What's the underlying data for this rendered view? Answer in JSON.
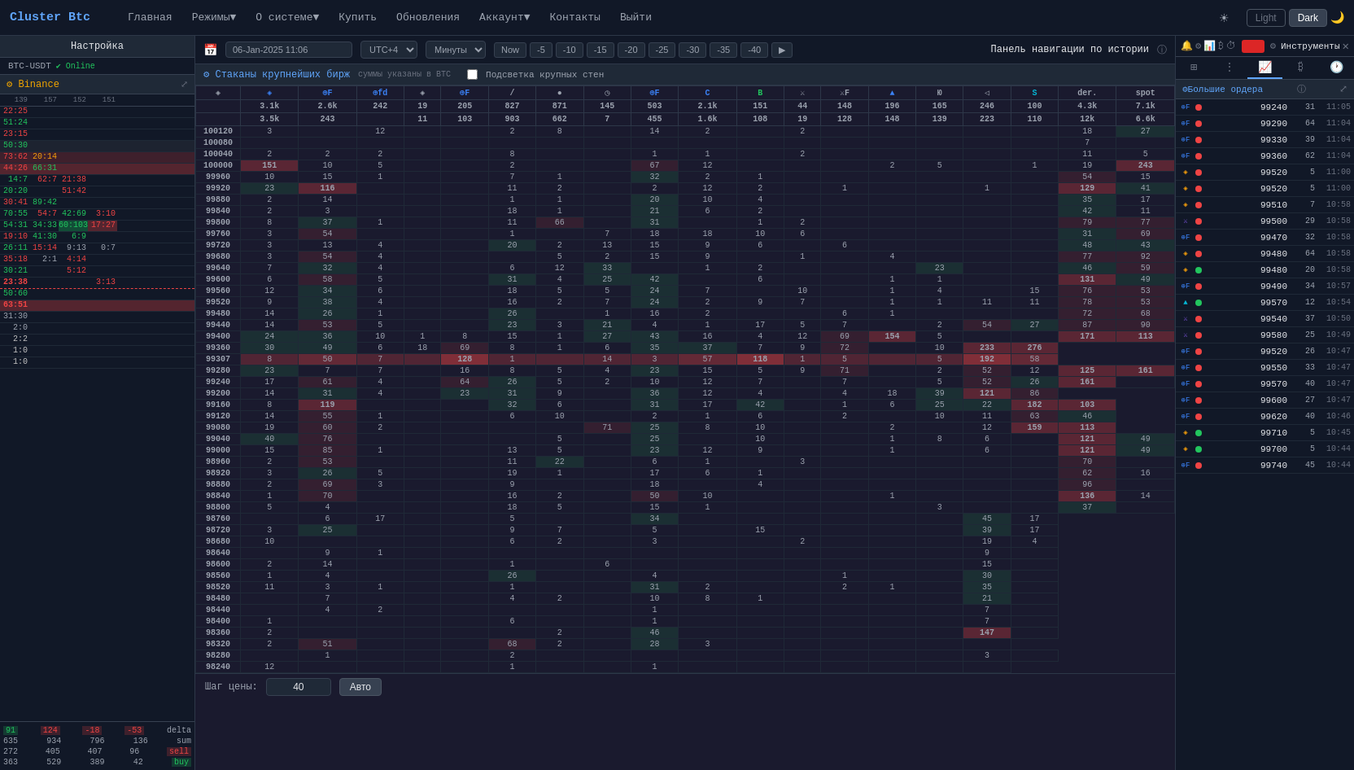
{
  "brand": "Cluster Btc",
  "nav": {
    "links": [
      "Главная",
      "Режимы▼",
      "О системе▼",
      "Купить",
      "Обновления",
      "Аккаунт▼",
      "Контакты",
      "Выйти"
    ],
    "theme": {
      "light": "Light",
      "dark": "Dark"
    }
  },
  "settings": {
    "title": "Настройка",
    "pair": "BTC-USDT",
    "status": "Online"
  },
  "history_nav": {
    "title": "Панель навигации по истории",
    "date": "06-Jan-2025 11:06",
    "tz": "UTC+4",
    "period": "Минуты",
    "btns": [
      "Now",
      "-5",
      "-10",
      "-15",
      "-20",
      "-25",
      "-30",
      "-35",
      "-40"
    ]
  },
  "instruments": {
    "title": "Инструменты"
  },
  "exchange": {
    "name": "⚙ Binance"
  },
  "cluster": {
    "title": "⚙ Стаканы крупнейших бирж",
    "note": "суммы указаны в BTC",
    "highlight": "Подсветка крупных стен"
  },
  "big_orders": {
    "title": "⚙Большие ордера"
  },
  "columns": {
    "headers": [
      "",
      "◈",
      "⊕F",
      "⊕fd",
      "◈",
      "⊕F",
      "/",
      "●",
      "◷",
      "⊕F",
      "C",
      "B",
      "⚔",
      "⚔F",
      "▲",
      "Ю",
      "◁",
      "S",
      "der.",
      "spot"
    ],
    "subvals": [
      "",
      "3.1k",
      "2.6k",
      "242",
      "19",
      "205",
      "827",
      "871",
      "145",
      "503",
      "2.1k",
      "151",
      "44",
      "148",
      "196",
      "165",
      "246",
      "100",
      "4.3k",
      "7.1k"
    ],
    "subvals2": [
      "",
      "3.5k",
      "243",
      "",
      "11",
      "103",
      "903",
      "662",
      "7",
      "455",
      "1.6k",
      "108",
      "19",
      "128",
      "148",
      "139",
      "223",
      "110",
      "12k",
      "6.6k"
    ]
  },
  "prices": [
    100120,
    100080,
    100040,
    100000,
    99960,
    99920,
    99880,
    99840,
    99800,
    99760,
    99720,
    99680,
    99640,
    99600,
    99560,
    99520,
    99480,
    99440,
    99400,
    99360,
    99307,
    99280,
    99240,
    99200,
    99160,
    99120,
    99080,
    99040,
    99000,
    98960,
    98920,
    98880,
    98840,
    98800,
    98760,
    98720,
    98680,
    98640,
    98600,
    98560,
    98520,
    98480,
    98440,
    98400,
    98360,
    98320,
    98280,
    98240
  ],
  "orders_list": [
    {
      "exchange": "⊕F",
      "side": "sell",
      "price": "99240",
      "size": "31",
      "time": "11:05"
    },
    {
      "exchange": "⊕F",
      "side": "sell",
      "price": "99290",
      "size": "64",
      "time": "11:04"
    },
    {
      "exchange": "⊕F",
      "side": "sell",
      "price": "99330",
      "size": "39",
      "time": "11:04"
    },
    {
      "exchange": "⊕F",
      "side": "sell",
      "price": "99360",
      "size": "62",
      "time": "11:04"
    },
    {
      "exchange": "◈",
      "side": "sell",
      "price": "99520",
      "size": "5",
      "time": "11:00"
    },
    {
      "exchange": "◈",
      "side": "sell",
      "price": "99520",
      "size": "5",
      "time": "11:00"
    },
    {
      "exchange": "◈",
      "side": "sell",
      "price": "99510",
      "size": "7",
      "time": "10:58"
    },
    {
      "exchange": "⚔",
      "side": "sell",
      "price": "99500",
      "size": "29",
      "time": "10:58"
    },
    {
      "exchange": "⊕F",
      "side": "sell",
      "price": "99470",
      "size": "32",
      "time": "10:58"
    },
    {
      "exchange": "◈",
      "side": "sell",
      "price": "99480",
      "size": "64",
      "time": "10:58"
    },
    {
      "exchange": "◈",
      "side": "buy",
      "price": "99480",
      "size": "20",
      "time": "10:58"
    },
    {
      "exchange": "⊕F",
      "side": "sell",
      "price": "99490",
      "size": "34",
      "time": "10:57"
    },
    {
      "exchange": "▲",
      "side": "buy",
      "price": "99570",
      "size": "12",
      "time": "10:54"
    },
    {
      "exchange": "⚔",
      "side": "sell",
      "price": "99540",
      "size": "37",
      "time": "10:50"
    },
    {
      "exchange": "⚔",
      "side": "sell",
      "price": "99580",
      "size": "25",
      "time": "10:49"
    },
    {
      "exchange": "⊕F",
      "side": "sell",
      "price": "99520",
      "size": "26",
      "time": "10:47"
    },
    {
      "exchange": "⊕F",
      "side": "sell",
      "price": "99550",
      "size": "33",
      "time": "10:47"
    },
    {
      "exchange": "⊕F",
      "side": "sell",
      "price": "99570",
      "size": "40",
      "time": "10:47"
    },
    {
      "exchange": "⊕F",
      "side": "sell",
      "price": "99600",
      "size": "27",
      "time": "10:47"
    },
    {
      "exchange": "⊕F",
      "side": "sell",
      "price": "99620",
      "size": "40",
      "time": "10:46"
    },
    {
      "exchange": "◈",
      "side": "buy",
      "price": "99710",
      "size": "5",
      "time": "10:45"
    },
    {
      "exchange": "◈",
      "side": "buy",
      "price": "99700",
      "size": "5",
      "time": "10:44"
    },
    {
      "exchange": "⊕F",
      "side": "sell",
      "price": "99740",
      "size": "45",
      "time": "10:44"
    }
  ],
  "step": {
    "label": "Шаг цены:",
    "value": "40",
    "auto": "Авто"
  },
  "left_col_data": {
    "labels": [
      "139",
      "157",
      "152",
      "151"
    ],
    "rows": [
      {
        "price": "100120",
        "v1": "3",
        "v2": "",
        "v3": "12",
        "bar": false,
        "red_bar": false
      },
      {
        "price": "100080",
        "v1": "",
        "v2": "",
        "v3": "",
        "bar": false,
        "red_bar": false
      },
      {
        "price": "100040",
        "v1": "2",
        "v2": "2",
        "v3": "2",
        "bar": false,
        "red_bar": false
      },
      {
        "price": "100000",
        "v1": "151",
        "v2": "10",
        "v3": "5",
        "bar": true,
        "red_bar": false
      },
      {
        "price": "99960",
        "v1": "10",
        "v2": "15",
        "v3": "1",
        "bar": false,
        "red_bar": false
      },
      {
        "price": "99920",
        "v1": "23",
        "v2": "116",
        "v3": "",
        "bar": false,
        "red_bar": false
      },
      {
        "price": "99880",
        "v1": "2",
        "v2": "14",
        "v3": "",
        "bar": false,
        "red_bar": false
      },
      {
        "price": "99840",
        "v1": "2",
        "v2": "3",
        "v3": "",
        "bar": false,
        "red_bar": false
      },
      {
        "price": "99800",
        "v1": "8",
        "v2": "37",
        "v3": "1",
        "bar": false,
        "red_bar": false
      },
      {
        "price": "99760",
        "v1": "3",
        "v2": "54",
        "v3": "",
        "bar": false,
        "red_bar": false
      },
      {
        "price": "99720",
        "v1": "3",
        "v2": "13",
        "v3": "4",
        "bar": false,
        "red_bar": false
      },
      {
        "price": "99680",
        "v1": "3",
        "v2": "54",
        "v3": "4",
        "bar": false,
        "red_bar": false
      },
      {
        "price": "99640",
        "v1": "7",
        "v2": "32",
        "v3": "4",
        "bar": false,
        "red_bar": false
      },
      {
        "price": "99600",
        "v1": "6",
        "v2": "58",
        "v3": "5",
        "bar": false,
        "red_bar": false
      },
      {
        "price": "99560",
        "v1": "12",
        "v2": "34",
        "v3": "6",
        "bar": false,
        "red_bar": false
      },
      {
        "price": "99520",
        "v1": "9",
        "v2": "38",
        "v3": "4",
        "bar": false,
        "red_bar": false
      },
      {
        "price": "99480",
        "v1": "14",
        "v2": "26",
        "v3": "1",
        "bar": false,
        "red_bar": false
      },
      {
        "price": "99440",
        "v1": "14",
        "v2": "53",
        "v3": "5",
        "bar": false,
        "red_bar": false
      },
      {
        "price": "99400",
        "v1": "24",
        "v2": "36",
        "v3": "10",
        "bar": false,
        "red_bar": false
      },
      {
        "price": "99360",
        "v1": "30",
        "v2": "49",
        "v3": "6",
        "bar": false,
        "red_bar": false
      },
      {
        "price": "99307",
        "v1": "8",
        "v2": "50",
        "v3": "7",
        "bar": false,
        "red_bar": true
      },
      {
        "price": "99280",
        "v1": "23",
        "v2": "7",
        "v3": "7",
        "bar": false,
        "red_bar": false
      },
      {
        "price": "99240",
        "v1": "17",
        "v2": "61",
        "v3": "4",
        "bar": false,
        "red_bar": false
      },
      {
        "price": "99200",
        "v1": "14",
        "v2": "31",
        "v3": "4",
        "bar": false,
        "red_bar": false
      },
      {
        "price": "99160",
        "v1": "8",
        "v2": "119",
        "v3": "",
        "bar": false,
        "red_bar": false
      },
      {
        "price": "99120",
        "v1": "14",
        "v2": "55",
        "v3": "1",
        "bar": false,
        "red_bar": false
      },
      {
        "price": "99080",
        "v1": "19",
        "v2": "60",
        "v3": "2",
        "bar": false,
        "red_bar": false
      },
      {
        "price": "99040",
        "v1": "40",
        "v2": "76",
        "v3": "",
        "bar": false,
        "red_bar": false
      },
      {
        "price": "99000",
        "v1": "15",
        "v2": "85",
        "v3": "1",
        "bar": false,
        "red_bar": false
      },
      {
        "price": "98960",
        "v1": "2",
        "v2": "53",
        "v3": "",
        "bar": false,
        "red_bar": false
      },
      {
        "price": "98920",
        "v1": "3",
        "v2": "26",
        "v3": "5",
        "bar": false,
        "red_bar": false
      },
      {
        "price": "98880",
        "v1": "2",
        "v2": "69",
        "v3": "3",
        "bar": false,
        "red_bar": false
      },
      {
        "price": "98840",
        "v1": "1",
        "v2": "70",
        "v3": "",
        "bar": false,
        "red_bar": false
      },
      {
        "price": "98800",
        "v1": "5",
        "v2": "4",
        "v3": "",
        "bar": false,
        "red_bar": false
      },
      {
        "price": "98760",
        "v1": "",
        "v2": "6",
        "v3": "17",
        "bar": false,
        "red_bar": false
      },
      {
        "price": "98720",
        "v1": "3",
        "v2": "25",
        "v3": "",
        "bar": false,
        "red_bar": false
      },
      {
        "price": "98680",
        "v1": "10",
        "v2": "",
        "v3": "",
        "bar": false,
        "red_bar": false
      },
      {
        "price": "98640",
        "v1": "",
        "v2": "9",
        "v3": "1",
        "bar": false,
        "red_bar": false
      },
      {
        "price": "98600",
        "v1": "2",
        "v2": "14",
        "v3": "",
        "bar": false,
        "red_bar": false
      },
      {
        "price": "98560",
        "v1": "1",
        "v2": "4",
        "v3": "",
        "bar": false,
        "red_bar": false
      },
      {
        "price": "98520",
        "v1": "11",
        "v2": "3",
        "v3": "1",
        "bar": false,
        "red_bar": false
      },
      {
        "price": "98480",
        "v1": "",
        "v2": "7",
        "v3": "",
        "bar": false,
        "red_bar": false
      },
      {
        "price": "98440",
        "v1": "",
        "v2": "4",
        "v3": "2",
        "bar": false,
        "red_bar": false
      },
      {
        "price": "98400",
        "v1": "1",
        "v2": "",
        "v3": "",
        "bar": false,
        "red_bar": false
      },
      {
        "price": "98360",
        "v1": "2",
        "v2": "",
        "v3": "",
        "bar": false,
        "red_bar": false
      },
      {
        "price": "98320",
        "v1": "2",
        "v2": "51",
        "v3": "",
        "bar": false,
        "red_bar": false
      },
      {
        "price": "98280",
        "v1": "",
        "v2": "1",
        "v3": "",
        "bar": false,
        "red_bar": false
      },
      {
        "price": "98240",
        "v1": "12",
        "v2": "",
        "v3": "",
        "bar": false,
        "red_bar": false
      }
    ]
  },
  "footer_stats": {
    "r1": {
      "v1": "91",
      "v2": "124",
      "v3": "-18",
      "v4": "-53",
      "label": "delta"
    },
    "r2": {
      "v1": "635",
      "v2": "934",
      "v3": "796",
      "v4": "136",
      "label": "sum"
    },
    "r3": {
      "v1": "272",
      "v2": "405",
      "v3": "407",
      "v4": "96",
      "label": "sell"
    },
    "r4": {
      "v1": "363",
      "v2": "529",
      "v3": "389",
      "v4": "42",
      "label": "buy"
    }
  }
}
